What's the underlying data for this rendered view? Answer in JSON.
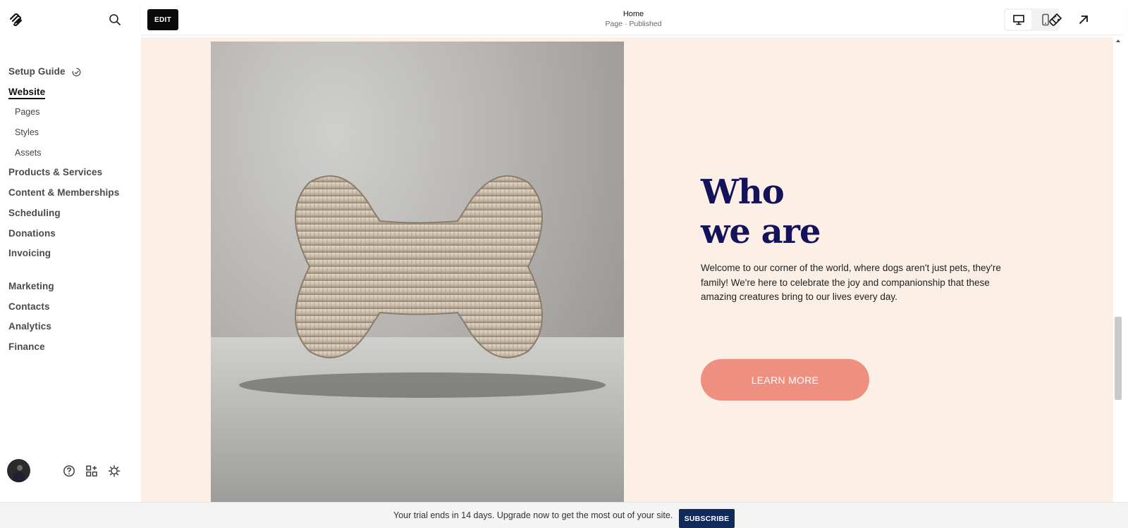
{
  "sidebar": {
    "nav": [
      {
        "label": "Setup Guide",
        "type": "main",
        "icon": "progress-icon"
      },
      {
        "label": "Website",
        "type": "main",
        "active": true
      },
      {
        "label": "Pages",
        "type": "sub"
      },
      {
        "label": "Styles",
        "type": "sub"
      },
      {
        "label": "Assets",
        "type": "sub"
      },
      {
        "label": "Products & Services",
        "type": "main"
      },
      {
        "label": "Content & Memberships",
        "type": "main"
      },
      {
        "label": "Scheduling",
        "type": "main"
      },
      {
        "label": "Donations",
        "type": "main"
      },
      {
        "label": "Invoicing",
        "type": "main"
      },
      {
        "label": "Marketing",
        "type": "main"
      },
      {
        "label": "Contacts",
        "type": "main"
      },
      {
        "label": "Analytics",
        "type": "main"
      },
      {
        "label": "Finance",
        "type": "main"
      }
    ],
    "footer_icons": [
      "help-icon",
      "apps-icon",
      "settings-icon"
    ]
  },
  "topbar": {
    "edit_label": "EDIT",
    "page_title": "Home",
    "page_status": "Page · Published",
    "device_mode": "desktop"
  },
  "hero": {
    "heading_line1": "Who",
    "heading_line2": "we are",
    "body": "Welcome to our corner of the world, where dogs aren't just pets, they're family! We're here to celebrate the joy and companionship that these amazing creatures bring to our lives every day.",
    "button_label": "LEARN MORE",
    "image_subject": "fabric dog bone toy"
  },
  "banner": {
    "text": "Your trial ends in 14 days. Upgrade now to get the most out of your site.",
    "button_label": "SUBSCRIBE"
  },
  "colors": {
    "canvas_bg": "#fcefe6",
    "heading": "#13125a",
    "button": "#ef8f80",
    "subscribe": "#102a5c"
  }
}
